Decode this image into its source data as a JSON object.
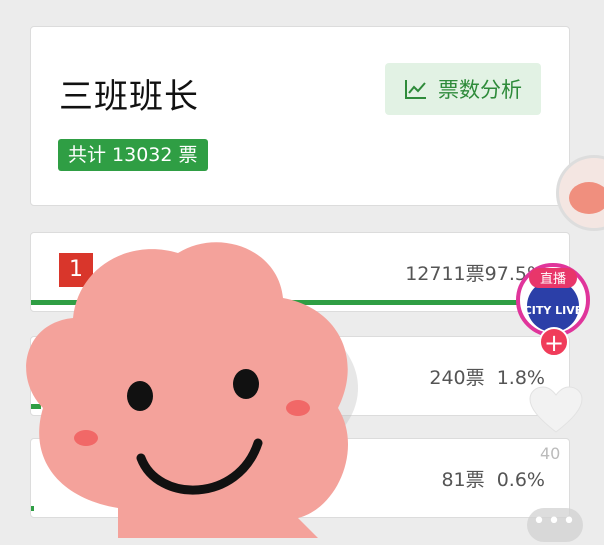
{
  "header": {
    "title": "三班班长",
    "analysis_button_label": "票数分析",
    "total_badge": "共计 13032 票"
  },
  "candidates": [
    {
      "rank": "1",
      "votes": "12711票",
      "percent": "97.5%",
      "share": 0.975
    },
    {
      "rank": "",
      "votes": "240票",
      "percent": "1.8%",
      "share": 0.018
    },
    {
      "rank": "",
      "votes": "81票",
      "percent": "0.6%",
      "share": 0.006
    }
  ],
  "live": {
    "badge_label": "直播",
    "logo_text": "CITY LIVE",
    "like_count": "40",
    "more_label": "•••"
  },
  "colors": {
    "accent_green": "#2f9e44",
    "rank_red": "#d9362b",
    "sticker_pink": "#f4a29b",
    "live_pink": "#f03c5a"
  },
  "icons": [
    "line-chart-icon",
    "plus-icon",
    "heart-icon",
    "more-icon"
  ]
}
